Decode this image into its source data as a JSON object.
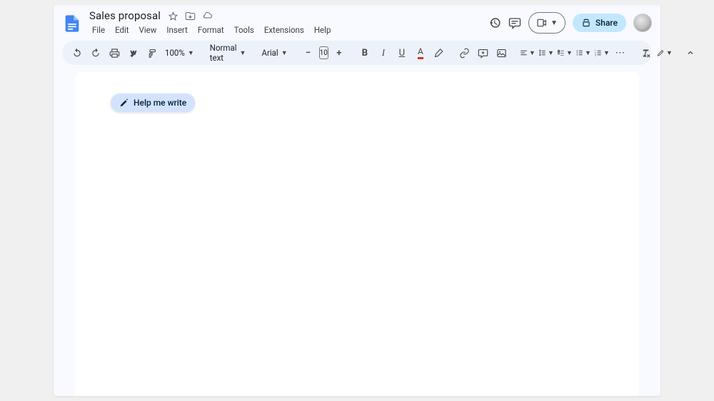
{
  "header": {
    "doc_title": "Sales proposal",
    "menus": [
      "File",
      "Edit",
      "View",
      "Insert",
      "Format",
      "Tools",
      "Extensions",
      "Help"
    ],
    "share_label": "Share"
  },
  "toolbar": {
    "zoom": "100%",
    "style": "Normal text",
    "font": "Arial",
    "font_size": "10"
  },
  "document": {
    "help_me_write_label": "Help me write"
  }
}
